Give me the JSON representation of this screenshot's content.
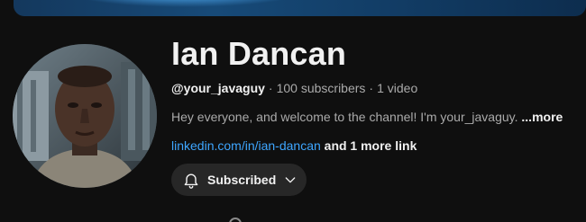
{
  "channel": {
    "name": "Ian Dancan",
    "handle": "@your_javaguy",
    "separator": "·",
    "subscribers": "100 subscribers",
    "videos": "1 video",
    "description": "Hey everyone, and welcome to the channel! I'm your_javaguy. ",
    "more_label": "...more",
    "link_text": "linkedin.com/in/ian-dancan",
    "more_links_text": "and 1 more link"
  },
  "subscribe_button": {
    "label": "Subscribed",
    "icon": "bell-icon",
    "dropdown_icon": "chevron-down-icon"
  },
  "colors": {
    "background": "#0f0f0f",
    "text_primary": "#f1f1f1",
    "text_secondary": "#aaaaaa",
    "link": "#3ea6ff",
    "button_bg": "#272727",
    "banner": "#174a78"
  }
}
